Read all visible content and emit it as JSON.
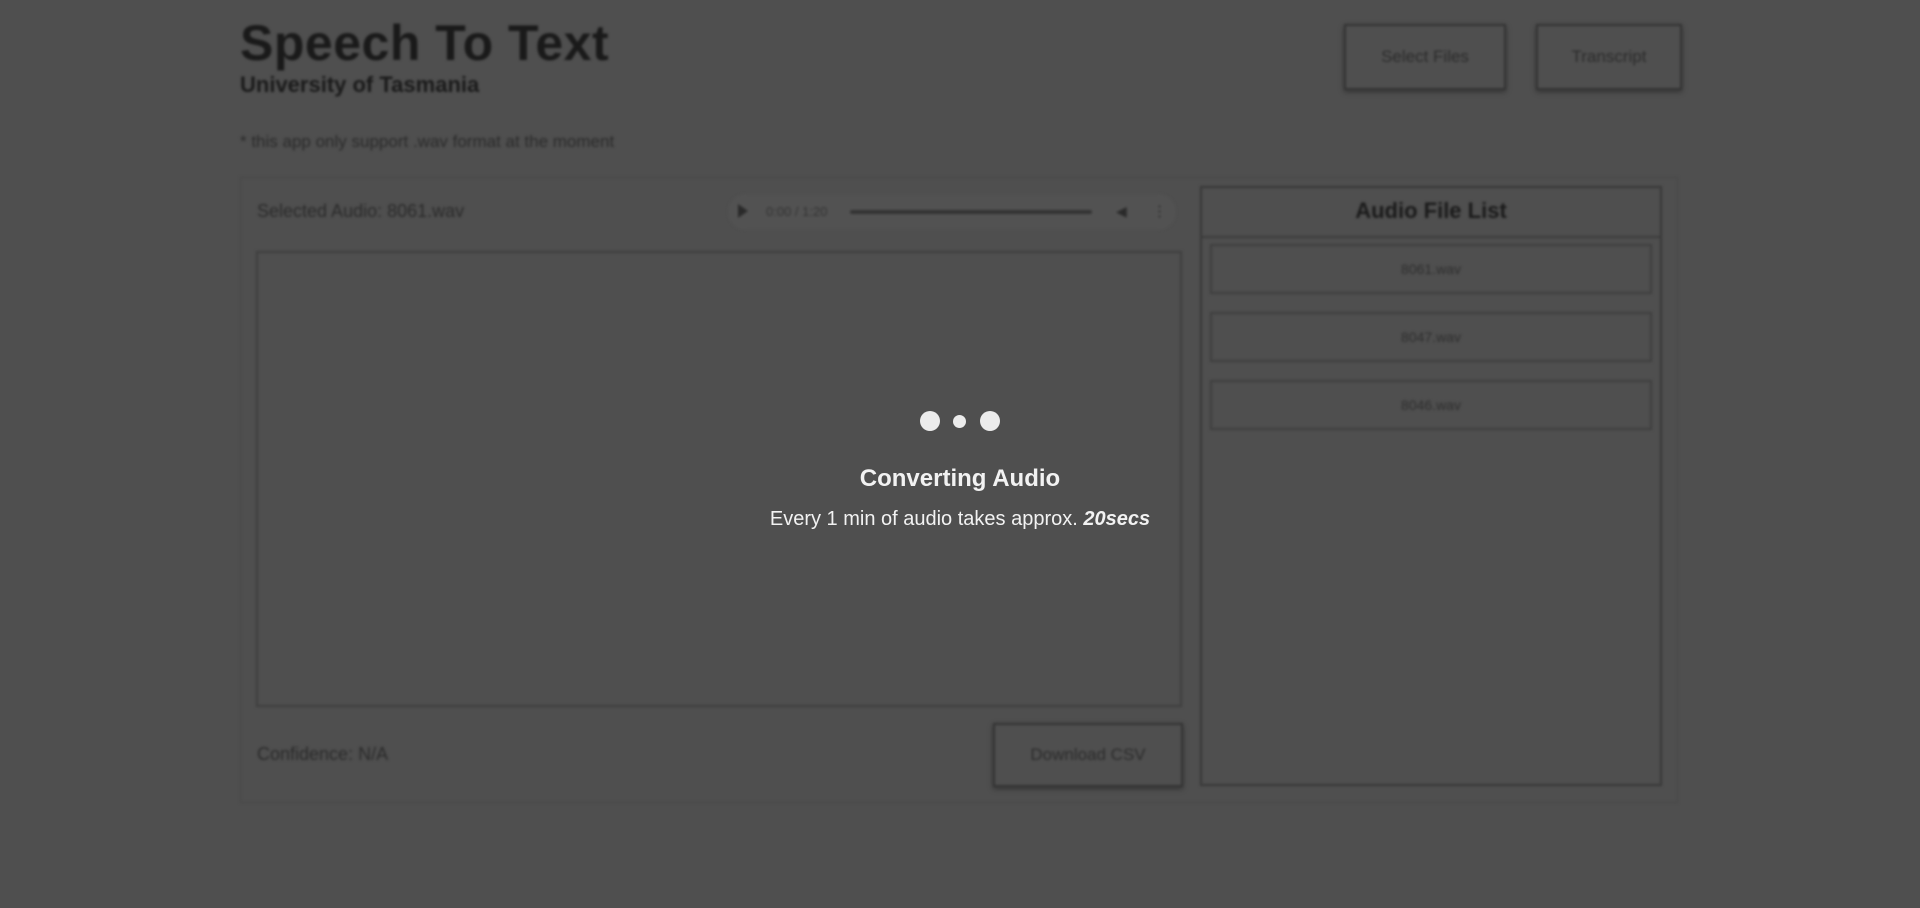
{
  "app": {
    "title": "Speech To Text",
    "subtitle": "University of Tasmania",
    "note": "* this app only support .wav format at the moment"
  },
  "toolbar": {
    "select_files_label": "Select Files",
    "transcript_label": "Transcript"
  },
  "player": {
    "selected_audio": "Selected Audio: 8061.wav",
    "time": "0:00 / 1:20",
    "play_icon": "play-icon",
    "volume_icon": "volume-icon",
    "more_icon": "more-vertical-icon"
  },
  "footer": {
    "confidence": "Confidence: N/A",
    "download_label": "Download CSV"
  },
  "file_list": {
    "title": "Audio File List",
    "items": [
      {
        "name": "8061.wav"
      },
      {
        "name": "8047.wav"
      },
      {
        "name": "8046.wav"
      }
    ]
  },
  "loading": {
    "title": "Converting Audio",
    "text": "Every 1 min of audio takes approx.",
    "emphasis": "20secs"
  }
}
